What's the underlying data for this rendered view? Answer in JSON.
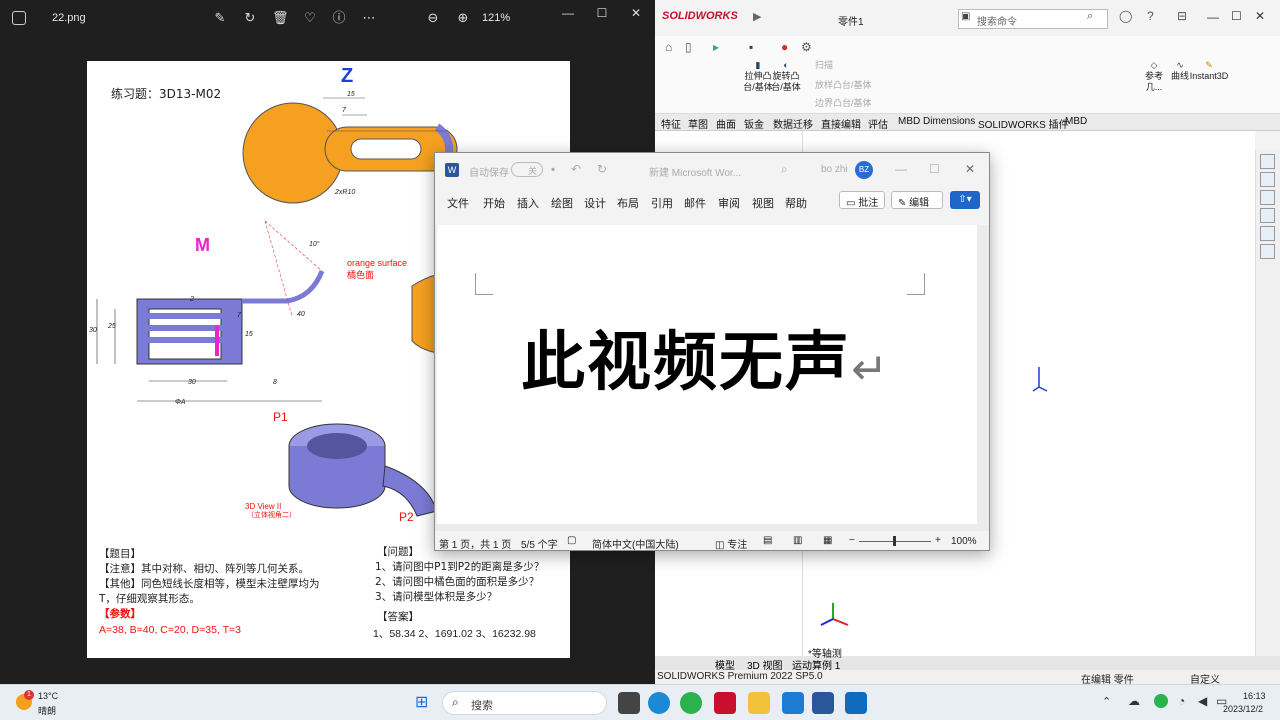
{
  "viewer": {
    "file_name": "22.png",
    "zoom": "121%"
  },
  "doc": {
    "title": "练习题：3D13-M02",
    "label_z": "Z",
    "label_m": "M",
    "orange_surface_en": "orange surface",
    "orange_surface_cn": "橘色面",
    "label_p1": "P1",
    "label_p2": "P2",
    "view_title": "3D View II",
    "view_subtitle": "（立体视角二）",
    "dims": {
      "d15": "15",
      "d7": "7",
      "d2r10": "2xR10",
      "d10deg": "10°",
      "d30": "30",
      "d25": "25",
      "d2": "2",
      "d15b": "15",
      "d7b": "7",
      "d30b": "30",
      "d8": "8",
      "dA": "ΦA",
      "d40": "40"
    },
    "left_block": {
      "h1": "【题目】",
      "l1": "【注意】其中对称、相切、阵列等几何关系。",
      "l2": "【其他】同色短线长度相等，模型未注壁厚均为",
      "l3": "T，仔细观察其形态。",
      "h2": "【参数】",
      "params": "A=38, B=40, C=20, D=35, T=3"
    },
    "right_block": {
      "h1": "【问题】",
      "q1": "1、请问图中P1到P2的距离是多少？",
      "q2": "2、请问图中橘色面的面积是多少？",
      "q3": "3、请问模型体积是多少？",
      "h2": "【答案】",
      "answers": "1、58.34 2、1691.02 3、16232.98"
    }
  },
  "solidworks": {
    "logo": "SOLIDWORKS",
    "doc_name": "零件1",
    "search_placeholder": "搜索命令",
    "ribbon": {
      "extrude": "拉伸凸台/基体",
      "revolve": "旋转凸台/基体",
      "sweep": "扫描",
      "loft": "放样凸台/基体",
      "boundary": "边界凸台/基体",
      "ref_geom": "参考几...",
      "curves": "曲线",
      "instant3d": "Instant3D"
    },
    "tabs": [
      "特征",
      "草图",
      "曲面",
      "钣金",
      "数据迁移",
      "直接编辑",
      "评估",
      "MBD Dimensions",
      "SOLIDWORKS 插件",
      "MBD"
    ],
    "bottom_tabs": [
      "模型",
      "3D 视图",
      "运动算例 1"
    ],
    "view_label": "*等轴测",
    "status_left": "SOLIDWORKS Premium 2022 SP5.0",
    "status_mid": "在编辑 零件",
    "status_right": "自定义"
  },
  "word": {
    "autosave": "自动保存",
    "autosave_state": "关",
    "doc_title": "新建 Microsoft Wor...",
    "user": "bo zhi",
    "user_initials": "BZ",
    "menu": [
      "文件",
      "开始",
      "插入",
      "绘图",
      "设计",
      "布局",
      "引用",
      "邮件",
      "审阅",
      "视图",
      "帮助"
    ],
    "comment_btn": "批注",
    "edit_btn": "编辑",
    "main_text": "此视频无声",
    "status_page": "第 1 页，共 1 页",
    "status_words": "5/5 个字",
    "status_lang": "简体中文(中国大陆)",
    "status_focus": "专注",
    "status_zoom": "100%"
  },
  "taskbar": {
    "weather_temp": "13°C",
    "weather_desc": "晴朗",
    "search": "搜索",
    "time": "16:13",
    "date": "2023/12/2",
    "notif_badge": "1"
  },
  "colors": {
    "orange": "#f5a020",
    "purple": "#7b7bd6",
    "magenta": "#ee22cc",
    "blue_label": "#1a3fd8"
  }
}
